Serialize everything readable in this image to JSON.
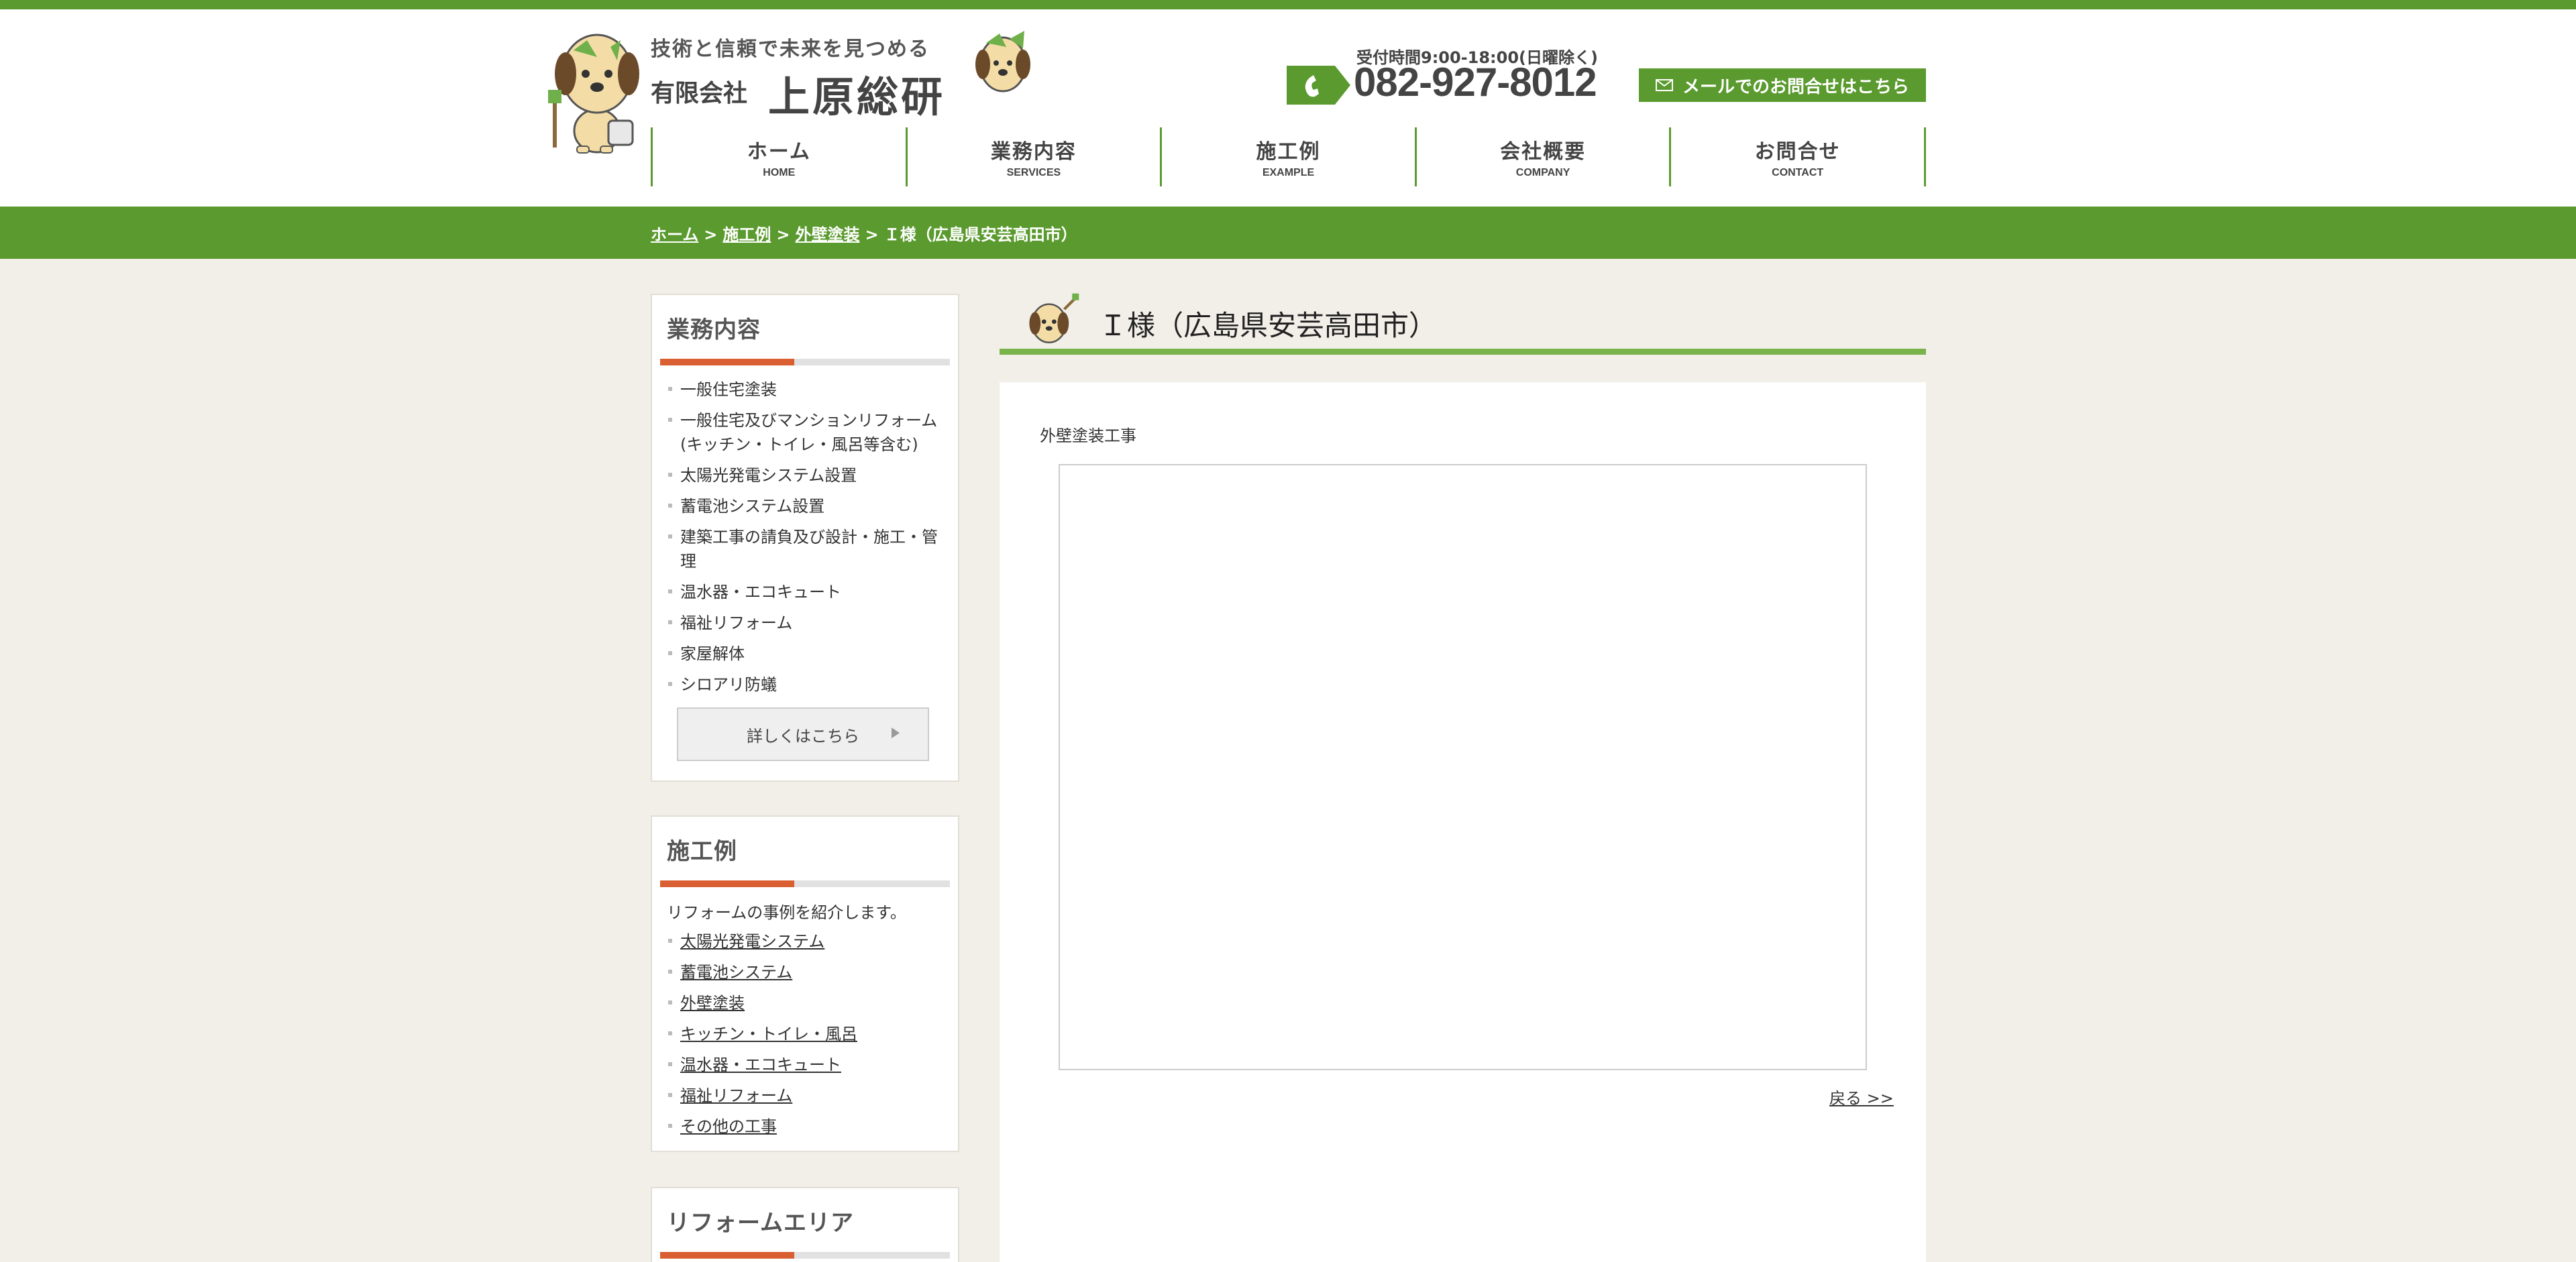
{
  "header": {
    "tagline": "技術と信頼で未来を見つめる",
    "company_type": "有限会社",
    "company_name": "上原総研",
    "hours": "受付時間9:00-18:00(日曜除く)",
    "phone": "082-927-8012",
    "mail_button": "メールでのお問合せはこちら"
  },
  "nav": [
    {
      "jp": "ホーム",
      "en": "HOME"
    },
    {
      "jp": "業務内容",
      "en": "SERVICES"
    },
    {
      "jp": "施工例",
      "en": "EXAMPLE"
    },
    {
      "jp": "会社概要",
      "en": "COMPANY"
    },
    {
      "jp": "お問合せ",
      "en": "CONTACT"
    }
  ],
  "breadcrumb": {
    "home": "ホーム",
    "sep": ">",
    "examples": "施工例",
    "category": "外壁塗装",
    "current": "Ｉ様（広島県安芸高田市）"
  },
  "sidebar": {
    "services": {
      "title": "業務内容",
      "items": [
        "一般住宅塗装",
        "一般住宅及びマンションリフォーム(キッチン・トイレ・風呂等含む)",
        "太陽光発電システム設置",
        "蓄電池システム設置",
        "建築工事の請負及び設計・施工・管理",
        "温水器・エコキュート",
        "福祉リフォーム",
        "家屋解体",
        "シロアリ防蟻"
      ],
      "more_button": "詳しくはこちら"
    },
    "examples": {
      "title": "施工例",
      "description": "リフォームの事例を紹介します。",
      "links": [
        "太陽光発電システム",
        "蓄電池システム",
        "外壁塗装",
        "キッチン・トイレ・風呂",
        "温水器・エコキュート",
        "福祉リフォーム",
        "その他の工事"
      ]
    },
    "area": {
      "title": "リフォームエリア"
    }
  },
  "main": {
    "title": "Ｉ様（広島県安芸高田市）",
    "work_label": "外壁塗装工事",
    "back_link": "戻る >>"
  },
  "colors": {
    "brand_green": "#5a9a2e",
    "accent_orange": "#d95f33",
    "title_rule_green": "#79b34a",
    "page_background": "#f2efe9"
  }
}
